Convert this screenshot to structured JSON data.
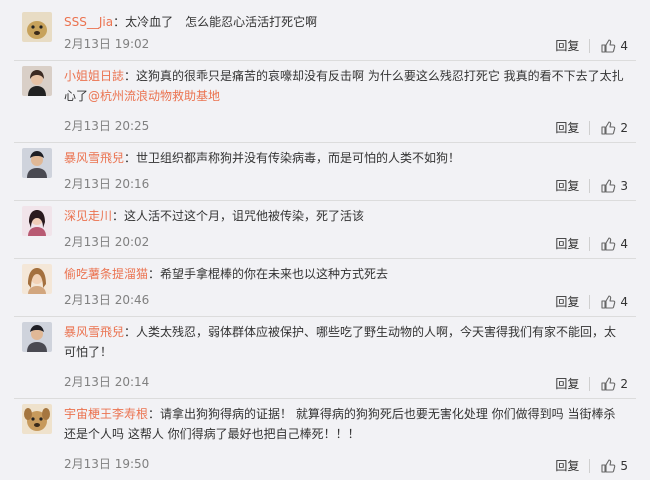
{
  "labels": {
    "reply": "回复"
  },
  "comments": [
    {
      "user": "SSS__Jia",
      "text": "：太冷血了　怎么能忍心活活打死它啊",
      "mention": "",
      "time": "2月13日 19:02",
      "likes": "4",
      "avatar_color": "#c7a25b"
    },
    {
      "user": "小姐姐日誌",
      "text": "：这狗真的很乖只是痛苦的哀嚎却没有反击啊 为什么要这么残忍打死它 我真的看不下去了太扎心了",
      "mention": "@杭州流浪动物救助基地",
      "time": "2月13日 20:25",
      "likes": "2",
      "avatar_color": "#8b6a5a"
    },
    {
      "user": "暴风雪飛兒",
      "text": "：世卫组织都声称狗并没有传染病毒，而是可怕的人类不如狗！",
      "mention": "",
      "time": "2月13日 20:16",
      "likes": "3",
      "avatar_color": "#4a4a52"
    },
    {
      "user": "深见走川",
      "text": "：这人活不过这个月，诅咒他被传染，死了活该",
      "mention": "",
      "time": "2月13日 20:02",
      "likes": "4",
      "avatar_color": "#b85a72"
    },
    {
      "user": "偷吃薯条提溜猫",
      "text": "：希望手拿棍棒的你在未来也以这种方式死去",
      "mention": "",
      "time": "2月13日 20:46",
      "likes": "4",
      "avatar_color": "#d2a67e"
    },
    {
      "user": "暴风雪飛兒",
      "text": "：人类太残忍，弱体群体应被保护、哪些吃了野生动物的人啊，今天害得我们有家不能回，太可怕了！",
      "mention": "",
      "time": "2月13日 20:14",
      "likes": "2",
      "avatar_color": "#4a4a52"
    },
    {
      "user": "宇宙梗王李寿根",
      "text": "：请拿出狗狗得病的证据！ 就算得病的狗狗死后也要无害化处理 你们做得到吗 当街棒杀 还是个人吗 这帮人 你们得病了最好也把自己棒死！！！",
      "mention": "",
      "time": "2月13日 19:50",
      "likes": "5",
      "avatar_color": "#b88a4a"
    }
  ]
}
